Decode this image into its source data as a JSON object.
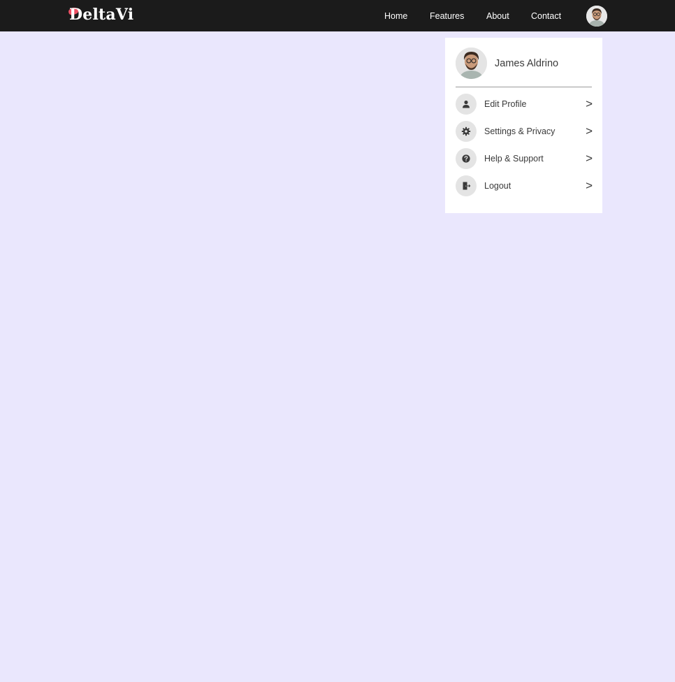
{
  "brand": {
    "name": "DeltaVi",
    "accent_color": "#ec4f63"
  },
  "nav": {
    "links": [
      {
        "label": "Home"
      },
      {
        "label": "Features"
      },
      {
        "label": "About"
      },
      {
        "label": "Contact"
      }
    ],
    "avatar_icon": "user-avatar"
  },
  "profile_menu": {
    "user_name": "James Aldrino",
    "items": [
      {
        "label": "Edit Profile",
        "icon": "person-icon",
        "arrow": ">"
      },
      {
        "label": "Settings & Privacy",
        "icon": "gear-icon",
        "arrow": ">"
      },
      {
        "label": "Help & Support",
        "icon": "help-icon",
        "arrow": ">"
      },
      {
        "label": "Logout",
        "icon": "logout-icon",
        "arrow": ">"
      }
    ]
  },
  "colors": {
    "navbar_bg": "#1b1b1b",
    "page_bg": "#eae7fd",
    "menu_bg": "#ffffff"
  }
}
